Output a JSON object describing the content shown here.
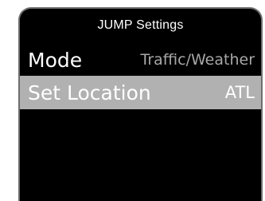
{
  "title": "JUMP Settings",
  "settings": [
    {
      "label": "Mode",
      "value": "Traffic/Weather",
      "selected": false
    },
    {
      "label": "Set Location",
      "value": "ATL",
      "selected": true
    }
  ]
}
